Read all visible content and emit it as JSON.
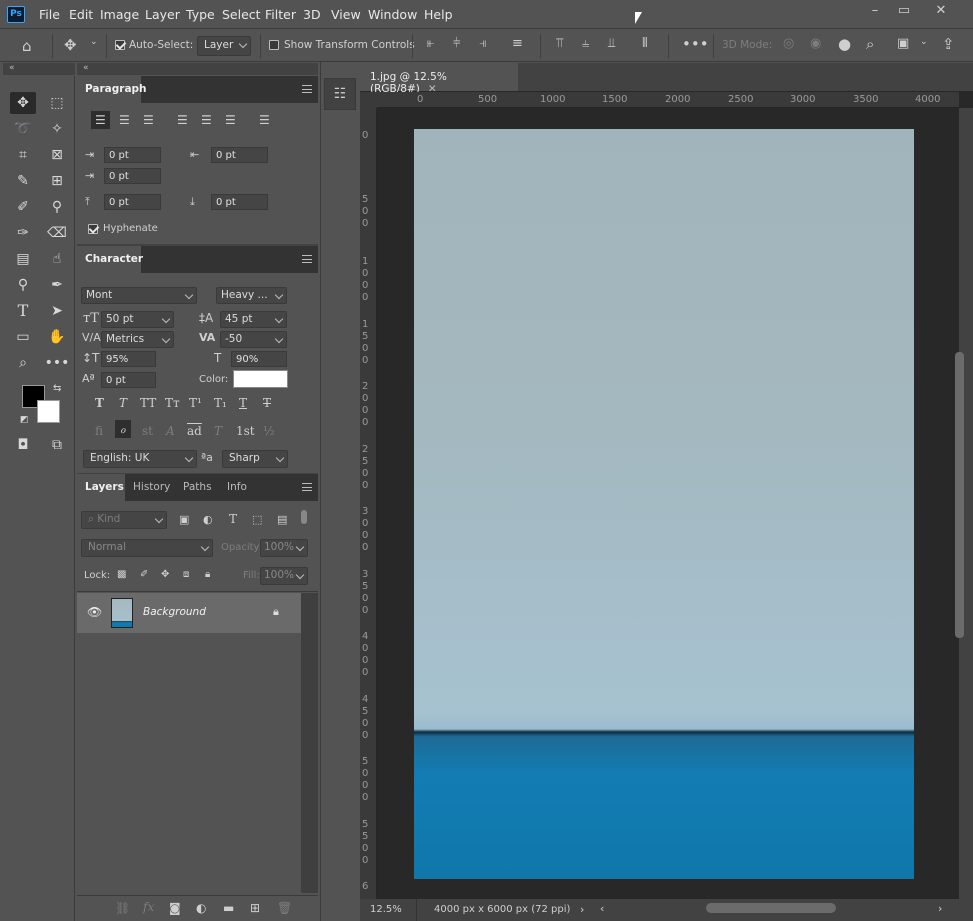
{
  "app": {
    "logo": "Ps"
  },
  "menu": [
    "File",
    "Edit",
    "Image",
    "Layer",
    "Type",
    "Select",
    "Filter",
    "3D",
    "View",
    "Window",
    "Help"
  ],
  "window_controls": {
    "minimize": "–",
    "maximize": "▭",
    "close": "✕"
  },
  "options": {
    "auto_select_label": "Auto-Select:",
    "auto_select_checked": true,
    "auto_select_target": "Layer",
    "show_transform_label": "Show Transform Controls",
    "show_transform_checked": false,
    "mode_3d_label": "3D Mode:"
  },
  "collapse": {
    "left": "«",
    "mid": "«",
    "right": "»"
  },
  "paragraph": {
    "tab": "Paragraph",
    "indent_left": "0 pt",
    "indent_right": "0 pt",
    "first_line": "0 pt",
    "space_before": "0 pt",
    "space_after": "0 pt",
    "hyphenate_label": "Hyphenate",
    "hyphenate_checked": true
  },
  "character": {
    "tab": "Character",
    "font_family": "Mont",
    "font_style": "Heavy ...",
    "font_size": "50 pt",
    "leading": "45 pt",
    "kerning": "Metrics",
    "tracking": "-50",
    "vertical_scale": "95%",
    "horizontal_scale": "90%",
    "baseline_shift": "0 pt",
    "color_label": "Color:",
    "color_value": "#ffffff",
    "language": "English: UK",
    "aa_label": "ªa",
    "antialias": "Sharp",
    "style_buttons": [
      "T",
      "T",
      "TT",
      "Tт",
      "T¹",
      "T₁",
      "T",
      "T"
    ],
    "opentype_buttons": [
      "fi",
      "ℴ",
      "st",
      "A",
      "ad",
      "T",
      "1st",
      "½"
    ]
  },
  "layers": {
    "tabs": [
      "Layers",
      "History",
      "Paths",
      "Info"
    ],
    "filter_kind": "Kind",
    "blend_mode": "Normal",
    "opacity_label": "Opacity:",
    "opacity_value": "100%",
    "lock_label": "Lock:",
    "fill_label": "Fill:",
    "fill_value": "100%",
    "items": [
      {
        "name": "Background",
        "visible": true,
        "locked": true
      }
    ]
  },
  "document": {
    "tab_title": "1.jpg @ 12.5% (RGB/8#)",
    "ruler_h": [
      "0",
      "500",
      "1000",
      "1500",
      "2000",
      "2500",
      "3000",
      "3500",
      "4000"
    ],
    "ruler_v": [
      "0",
      "500",
      "1000",
      "1500",
      "2000",
      "2500",
      "3000",
      "3500",
      "4000",
      "4500",
      "5000",
      "5500",
      "6"
    ],
    "zoom": "12.5%",
    "doc_info": "4000 px x 6000 px (72 ppi)"
  },
  "colors": {
    "foreground": "#000000",
    "background": "#ffffff",
    "accent": "#31a8ff"
  }
}
